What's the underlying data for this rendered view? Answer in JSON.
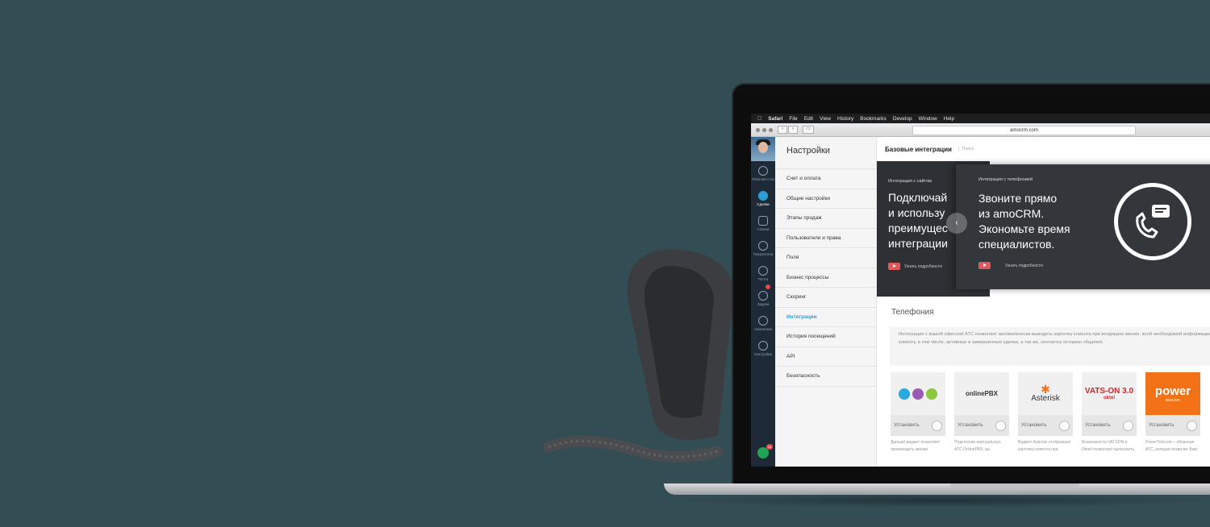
{
  "colors": {
    "background": "#334d54",
    "accent": "#2d9fd8",
    "play": "#e0575c",
    "power_orange": "#f47216"
  },
  "menubar": {
    "apple_icon": "apple-icon",
    "items": [
      "Safari",
      "File",
      "Edit",
      "View",
      "History",
      "Bookmarks",
      "Develop",
      "Window",
      "Help"
    ]
  },
  "browser": {
    "url": "amocrm.com"
  },
  "leftnav": {
    "items": [
      {
        "label": "Рабочий стол",
        "icon": "dashboard-icon"
      },
      {
        "label": "Сделки",
        "icon": "deals-icon",
        "active": true
      },
      {
        "label": "Списки",
        "icon": "lists-icon"
      },
      {
        "label": "Покупатели",
        "icon": "customers-icon"
      },
      {
        "label": "Почта",
        "icon": "mail-icon"
      },
      {
        "label": "Задачи",
        "icon": "tasks-icon"
      },
      {
        "label": "Аналитика",
        "icon": "analytics-icon"
      },
      {
        "label": "Настройки",
        "icon": "settings-icon"
      }
    ],
    "chat_badge": "15"
  },
  "settings": {
    "title": "Настройки",
    "items": [
      "Счет и оплата",
      "Общие настройки",
      "Этапы продаж",
      "Пользователи и права",
      "Поля",
      "Бизнес процессы",
      "Скоринг",
      "Интеграции",
      "История посещений",
      "API",
      "Безопасность"
    ],
    "active": "Интеграции"
  },
  "main": {
    "title": "Базовые интеграции",
    "search_placeholder": "Поиск",
    "banner1": {
      "subtitle": "Интеграция с сайтом",
      "title_lines": [
        "Подключай",
        "и использу",
        "преимущес",
        "интеграции"
      ],
      "more": "Узнать подробности"
    },
    "banner2": {
      "subtitle": "Интеграция с телефонией",
      "title_lines": [
        "Звоните прямо",
        "из amoCRM.",
        "Экономьте время",
        "специалистов."
      ],
      "more": "Узнать подробности"
    },
    "section_title": "Телефония",
    "section_desc": "Интеграция с вашей офисной АТС позволяет автоматически выводить карточку клиента при входящем звонке, всей необходимой информации по клиенту, в том числе, активные и завершенные сделки, а так же, контактну историю общения.",
    "cards": [
      {
        "logo": "",
        "install": "Установить",
        "desc": "Данный виджет позволяет производить звонки"
      },
      {
        "logo": "onlinePBX",
        "install": "Установить",
        "desc": "Подключив виртуальную АТС OnlinePBX, вы"
      },
      {
        "logo": "Asterisk",
        "install": "Установить",
        "desc": "Виджет Asterisk отображает карточку клиента при"
      },
      {
        "logo": "VATS-ON 3.0",
        "logo_sub": "oktel",
        "install": "Установить",
        "desc": "Возможности VATSON и Oktell позволяют выполнить"
      },
      {
        "logo": "power",
        "logo_sub": "telecom",
        "install": "Установить",
        "desc": "PowerTelecom – облачная АТС, которая позволит Вам"
      }
    ]
  }
}
